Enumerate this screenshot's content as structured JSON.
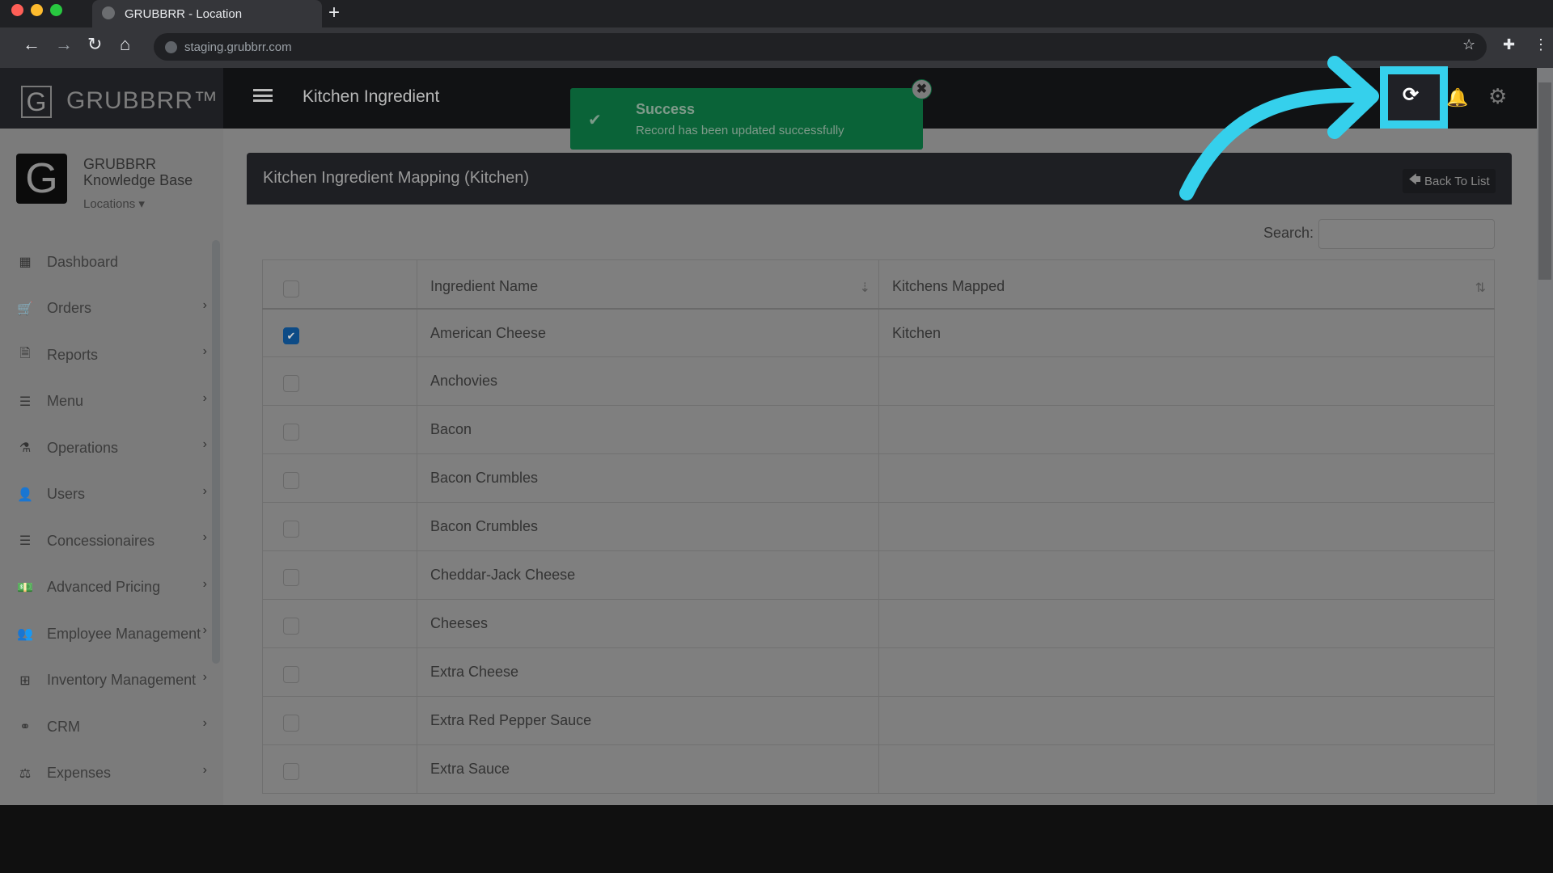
{
  "browser": {
    "tab_title": "GRUBBRR - Location",
    "url": "staging.grubbrr.com",
    "new_tab": "+"
  },
  "app": {
    "brand": "GRUBBRR™",
    "logo_letter": "G",
    "page_title": "Kitchen Ingredient"
  },
  "account": {
    "name_line1": "GRUBBRR",
    "name_line2": "Knowledge Base",
    "locations": "Locations ▾"
  },
  "sidebar": {
    "items": [
      {
        "label": "Dashboard",
        "icon": "dashboard-icon",
        "glyph": "▦",
        "chevron": false
      },
      {
        "label": "Orders",
        "icon": "cart-icon",
        "glyph": "🛒",
        "chevron": true
      },
      {
        "label": "Reports",
        "icon": "document-icon",
        "glyph": "🗎",
        "chevron": true
      },
      {
        "label": "Menu",
        "icon": "list-icon",
        "glyph": "☰",
        "chevron": true
      },
      {
        "label": "Operations",
        "icon": "flask-icon",
        "glyph": "⚗",
        "chevron": true
      },
      {
        "label": "Users",
        "icon": "user-plus-icon",
        "glyph": "👤",
        "chevron": true
      },
      {
        "label": "Concessionaires",
        "icon": "list-icon",
        "glyph": "☰",
        "chevron": true
      },
      {
        "label": "Advanced Pricing",
        "icon": "money-icon",
        "glyph": "💵",
        "chevron": true
      },
      {
        "label": "Employee Management",
        "icon": "users-icon",
        "glyph": "👥",
        "chevron": true
      },
      {
        "label": "Inventory Management",
        "icon": "sitemap-icon",
        "glyph": "⊞",
        "chevron": true
      },
      {
        "label": "CRM",
        "icon": "link-icon",
        "glyph": "⚭",
        "chevron": true
      },
      {
        "label": "Expenses",
        "icon": "balance-scale-icon",
        "glyph": "⚖",
        "chevron": true
      }
    ]
  },
  "panel": {
    "title": "Kitchen Ingredient Mapping (Kitchen)",
    "back_label": "Back To List",
    "search_label": "Search:",
    "search_value": ""
  },
  "table": {
    "columns": [
      "",
      "Ingredient Name",
      "Kitchens Mapped"
    ],
    "rows": [
      {
        "checked": true,
        "name": "American Cheese",
        "kitchens": "Kitchen"
      },
      {
        "checked": false,
        "name": "Anchovies",
        "kitchens": ""
      },
      {
        "checked": false,
        "name": "Bacon",
        "kitchens": ""
      },
      {
        "checked": false,
        "name": "Bacon Crumbles",
        "kitchens": ""
      },
      {
        "checked": false,
        "name": "Bacon Crumbles",
        "kitchens": ""
      },
      {
        "checked": false,
        "name": "Cheddar-Jack Cheese",
        "kitchens": ""
      },
      {
        "checked": false,
        "name": "Cheeses",
        "kitchens": ""
      },
      {
        "checked": false,
        "name": "Extra Cheese",
        "kitchens": ""
      },
      {
        "checked": false,
        "name": "Extra Red Pepper Sauce",
        "kitchens": ""
      },
      {
        "checked": false,
        "name": "Extra Sauce",
        "kitchens": ""
      }
    ]
  },
  "toast": {
    "title": "Success",
    "message": "Record has been updated successfully"
  },
  "colors": {
    "annotation": "#35d0ec",
    "toast": "#0a6338",
    "checkbox": "#0d4b86"
  }
}
